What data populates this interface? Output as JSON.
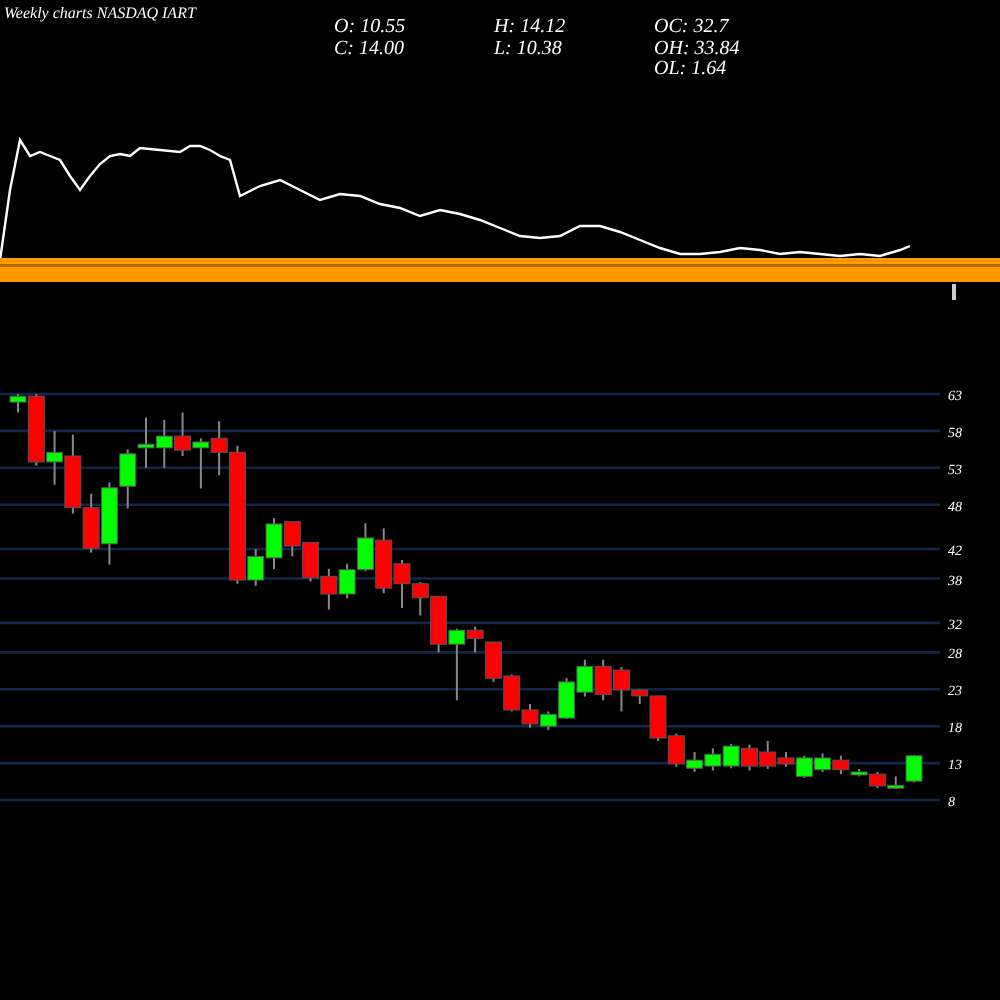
{
  "title": "Weekly charts NASDAQ IART",
  "stats": [
    {
      "label": "O:",
      "value": "10.55"
    },
    {
      "label": "H:",
      "value": "14.12"
    },
    {
      "label": "OC:",
      "value": "32.7"
    },
    {
      "label": "C:",
      "value": "14.00"
    },
    {
      "label": "L:",
      "value": "10.38"
    },
    {
      "label": "OH:",
      "value": "33.84"
    },
    {
      "label": "OL:",
      "value": "1.64"
    }
  ],
  "price_chart": {
    "chart_data": {
      "type": "candlestick",
      "ylim": [
        8,
        63
      ],
      "yticks": [
        {
          "value": 63,
          "label": "63"
        },
        {
          "value": 58,
          "label": "58"
        },
        {
          "value": 53,
          "label": "53"
        },
        {
          "value": 48,
          "label": "48"
        },
        {
          "value": 42,
          "label": "42"
        },
        {
          "value": 38,
          "label": "38"
        },
        {
          "value": 32,
          "label": "32"
        },
        {
          "value": 28,
          "label": "28"
        },
        {
          "value": 23,
          "label": "23"
        },
        {
          "value": 18,
          "label": "18"
        },
        {
          "value": 13,
          "label": "13"
        },
        {
          "value": 8,
          "label": "8"
        }
      ],
      "grid": true,
      "ohlc": [
        [
          61.9,
          63.0,
          60.5,
          62.7
        ],
        [
          62.7,
          63.0,
          53.3,
          53.8
        ],
        [
          53.8,
          58.0,
          50.7,
          55.1
        ],
        [
          54.6,
          57.5,
          46.8,
          47.6
        ],
        [
          47.6,
          49.5,
          41.5,
          42.1
        ],
        [
          42.7,
          51.0,
          39.9,
          50.3
        ],
        [
          50.5,
          55.5,
          47.5,
          54.9
        ],
        [
          55.7,
          59.8,
          53.0,
          56.2
        ],
        [
          55.7,
          59.5,
          53.0,
          57.3
        ],
        [
          57.3,
          60.5,
          54.6,
          55.4
        ],
        [
          55.7,
          57.0,
          50.2,
          56.5
        ],
        [
          57.0,
          59.3,
          52.0,
          55.1
        ],
        [
          55.1,
          56.0,
          37.3,
          37.8
        ],
        [
          37.8,
          42.0,
          37.0,
          41.0
        ],
        [
          40.8,
          46.2,
          39.3,
          45.4
        ],
        [
          45.7,
          45.7,
          41.0,
          42.4
        ],
        [
          42.9,
          42.9,
          37.6,
          38.1
        ],
        [
          38.3,
          39.3,
          33.8,
          35.9
        ],
        [
          35.9,
          40.0,
          35.3,
          39.2
        ],
        [
          39.2,
          45.5,
          39.0,
          43.5
        ],
        [
          43.2,
          44.8,
          36.0,
          36.7
        ],
        [
          40.0,
          40.5,
          34.0,
          37.3
        ],
        [
          37.3,
          37.5,
          33.0,
          35.4
        ],
        [
          35.6,
          35.6,
          28.0,
          29.1
        ],
        [
          29.1,
          31.2,
          21.5,
          31.0
        ],
        [
          31.0,
          31.5,
          28.0,
          29.9
        ],
        [
          29.4,
          29.4,
          24.0,
          24.5
        ],
        [
          24.8,
          25.0,
          20.0,
          20.2
        ],
        [
          20.2,
          21.0,
          17.8,
          18.3
        ],
        [
          18.0,
          20.0,
          17.5,
          19.6
        ],
        [
          19.1,
          24.5,
          19.0,
          24.0
        ],
        [
          22.6,
          27.0,
          22.0,
          26.1
        ],
        [
          26.1,
          27.0,
          21.5,
          22.3
        ],
        [
          25.6,
          26.0,
          20.0,
          22.9
        ],
        [
          22.9,
          23.0,
          21.0,
          22.1
        ],
        [
          22.1,
          22.1,
          16.0,
          16.4
        ],
        [
          16.7,
          17.0,
          12.5,
          12.9
        ],
        [
          12.3,
          14.5,
          11.8,
          13.4
        ],
        [
          12.6,
          15.0,
          12.0,
          14.2
        ],
        [
          12.6,
          15.6,
          12.3,
          15.3
        ],
        [
          15.0,
          15.5,
          12.0,
          12.6
        ],
        [
          14.5,
          16.0,
          12.2,
          12.6
        ],
        [
          13.7,
          14.5,
          12.5,
          12.9
        ],
        [
          11.2,
          14.0,
          11.0,
          13.7
        ],
        [
          12.1,
          14.3,
          11.8,
          13.7
        ],
        [
          13.4,
          14.0,
          11.5,
          12.1
        ],
        [
          11.5,
          12.2,
          11.2,
          11.8
        ],
        [
          11.5,
          11.8,
          9.6,
          9.9
        ],
        [
          9.6,
          11.2,
          9.5,
          10.0
        ],
        [
          10.55,
          14.12,
          10.38,
          14.0
        ]
      ]
    }
  }
}
